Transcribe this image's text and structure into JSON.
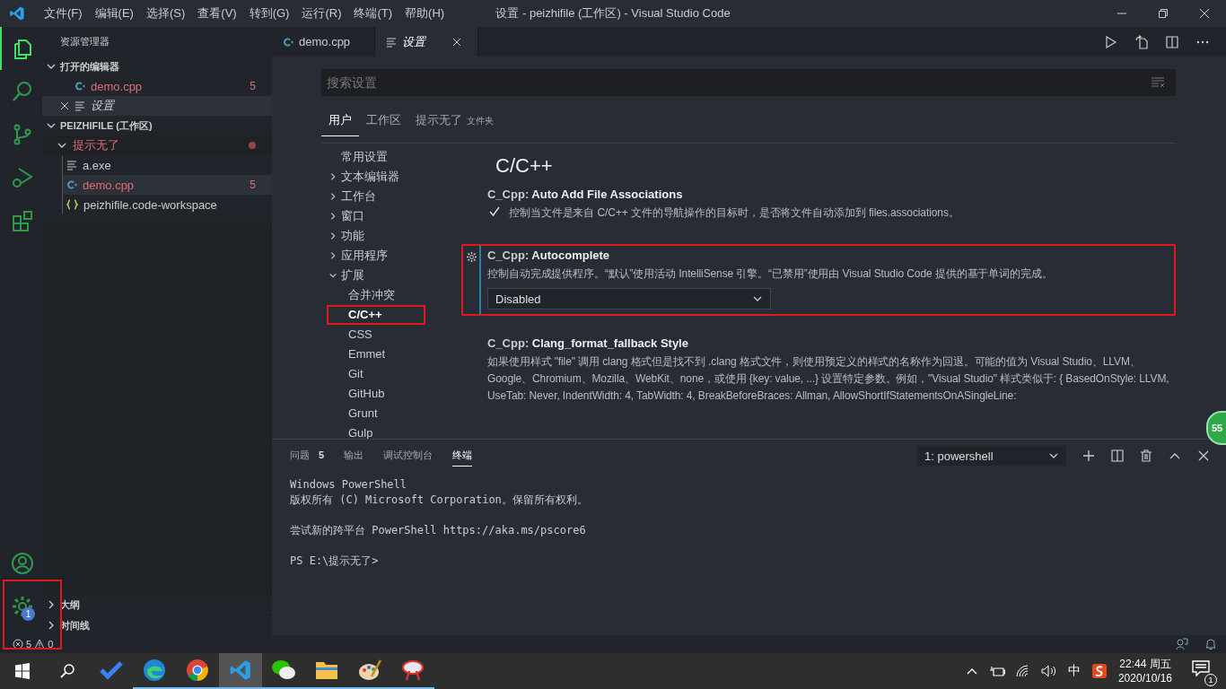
{
  "window": {
    "title": "设置 - peizhifile (工作区) - Visual Studio Code"
  },
  "menu": [
    "文件(F)",
    "编辑(E)",
    "选择(S)",
    "查看(V)",
    "转到(G)",
    "运行(R)",
    "终端(T)",
    "帮助(H)"
  ],
  "activity_bar": {
    "items": [
      {
        "kind": "explorer",
        "selected": true
      },
      {
        "kind": "search",
        "selected": false
      },
      {
        "kind": "scm",
        "selected": false
      },
      {
        "kind": "debug",
        "selected": false
      },
      {
        "kind": "extensions",
        "selected": false
      }
    ],
    "account": {
      "kind": "account"
    },
    "manage": {
      "badge": "1",
      "highlighted": true
    }
  },
  "sidebar": {
    "title": "资源管理器",
    "open_editors": {
      "title": "打开的编辑器",
      "expanded": true,
      "items": [
        {
          "name": "demo.cpp",
          "kind": "cpp",
          "problems": "5",
          "selected": false
        },
        {
          "name": "设置",
          "kind": "settings",
          "selected": true
        }
      ]
    },
    "workspace": {
      "title": "PEIZHIFILE (工作区)",
      "expanded": true,
      "folders": [
        {
          "name": "提示无了",
          "expanded": true,
          "modified": true,
          "children": [
            {
              "name": "a.exe",
              "kind": "file",
              "selected": false
            },
            {
              "name": "demo.cpp",
              "kind": "cpp",
              "problems": "5",
              "selected": true
            },
            {
              "name": "peizhifile.code-workspace",
              "kind": "json",
              "selected": false
            }
          ]
        }
      ]
    },
    "sections": [
      {
        "title": "大纲",
        "expanded": false
      },
      {
        "title": "时间线",
        "expanded": false
      }
    ]
  },
  "editor_tabs": [
    {
      "label": "demo.cpp",
      "kind": "cpp",
      "selected": false
    },
    {
      "label": "设置",
      "kind": "settings",
      "selected": true
    }
  ],
  "settings": {
    "search": {
      "placeholder": "搜索设置"
    },
    "scopes": [
      {
        "label": "用户",
        "selected": true
      },
      {
        "label": "工作区",
        "selected": false
      },
      {
        "label": "提示无了",
        "suffix": "文件夹",
        "selected": false
      }
    ],
    "toc": [
      {
        "label": "常用设置"
      },
      {
        "label": "文本编辑器",
        "expanded": false
      },
      {
        "label": "工作台",
        "expanded": false
      },
      {
        "label": "窗口",
        "expanded": false
      },
      {
        "label": "功能",
        "expanded": false
      },
      {
        "label": "应用程序",
        "expanded": false
      },
      {
        "label": "扩展",
        "expanded": true,
        "children": [
          {
            "label": "合并冲突",
            "selected": false,
            "highlighted": false
          },
          {
            "label": "C/C++",
            "selected": true,
            "highlighted": true
          },
          {
            "label": "CSS",
            "selected": false,
            "highlighted": false
          },
          {
            "label": "Emmet",
            "selected": false,
            "highlighted": false
          },
          {
            "label": "Git",
            "selected": false,
            "highlighted": false
          },
          {
            "label": "GitHub",
            "selected": false,
            "highlighted": false
          },
          {
            "label": "Grunt",
            "selected": false,
            "highlighted": false
          },
          {
            "label": "Gulp",
            "selected": false,
            "highlighted": false
          }
        ]
      }
    ],
    "section_title": "C/C++",
    "items": [
      {
        "kind": "checkbox",
        "prefix": "C_Cpp: ",
        "name": "Auto Add File Associations",
        "description": "控制当文件是来自 C/C++ 文件的导航操作的目标时，是否将文件自动添加到 files.associations。",
        "checked": true,
        "focused": false,
        "highlighted": false
      },
      {
        "kind": "dropdown",
        "prefix": "C_Cpp: ",
        "name": "Autocomplete",
        "description": "控制自动完成提供程序。“默认”使用活动 IntelliSense 引擎。“已禁用”使用由 Visual Studio Code 提供的基于单词的完成。",
        "value": "Disabled",
        "focused": true,
        "highlighted": true
      },
      {
        "kind": "text",
        "prefix": "C_Cpp: ",
        "name": "Clang_format_fallback Style",
        "description": "如果使用样式 \"file\" 调用 clang 格式但是找不到 .clang 格式文件，则使用预定义的样式的名称作为回退。可能的值为 Visual Studio、LLVM、Google、Chromium、Mozilla、WebKit、none，或使用 {key: value, ...} 设置特定参数。例如，\"Visual Studio\" 样式类似于: { BasedOnStyle: LLVM, UseTab: Never, IndentWidth: 4, TabWidth: 4, BreakBeforeBraces: Allman, AllowShortIfStatementsOnASingleLine:",
        "focused": false,
        "highlighted": false
      }
    ]
  },
  "panel": {
    "tabs": [
      {
        "label": "问题",
        "count": "5",
        "selected": false
      },
      {
        "label": "输出",
        "selected": false
      },
      {
        "label": "调试控制台",
        "selected": false
      },
      {
        "label": "终端",
        "selected": true
      }
    ],
    "terminal_select": "1: powershell",
    "terminal_blocks": [
      [
        "Windows PowerShell",
        "版权所有 (C) Microsoft Corporation。保留所有权利。"
      ],
      [
        "尝试新的跨平台 PowerShell https://aka.ms/pscore6"
      ],
      [
        "PS E:\\提示无了>"
      ]
    ]
  },
  "floating_badge": "55",
  "status_bar": {
    "errors": "5",
    "warnings": "0"
  },
  "taskbar": {
    "apps": [
      {
        "kind": "todo",
        "running": false,
        "selected": false
      },
      {
        "kind": "edge",
        "running": true,
        "selected": false
      },
      {
        "kind": "chrome",
        "running": true,
        "selected": false
      },
      {
        "kind": "vscode",
        "running": true,
        "selected": true
      },
      {
        "kind": "wechat",
        "running": true,
        "selected": false
      },
      {
        "kind": "folder",
        "running": true,
        "selected": false
      },
      {
        "kind": "paint",
        "running": true,
        "selected": false
      },
      {
        "kind": "tool",
        "running": true,
        "selected": false
      }
    ],
    "tray": {
      "ime": "中",
      "time": "22:44 周五",
      "date": "2020/10/16",
      "notifications": "1"
    }
  }
}
